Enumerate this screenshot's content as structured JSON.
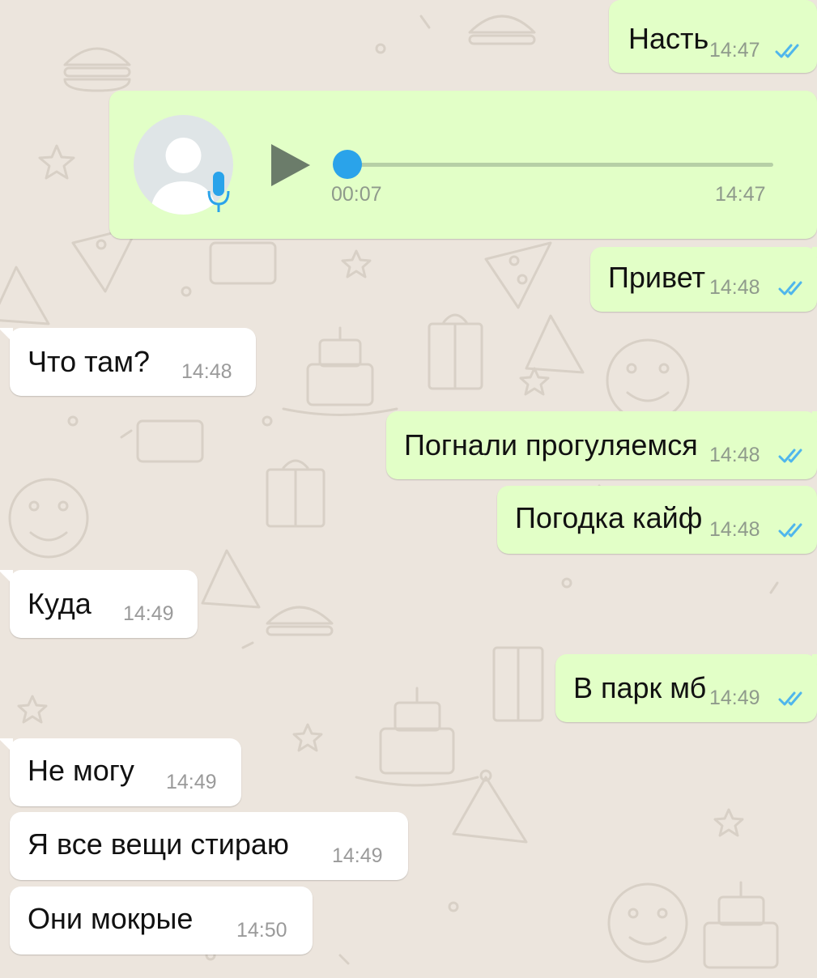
{
  "chat": {
    "messages": [
      {
        "direction": "out",
        "text": "Насть",
        "time": "14:47",
        "status": "read"
      },
      {
        "direction": "out",
        "type": "voice",
        "duration": "00:07",
        "time": "14:47",
        "playback_progress": 0.0
      },
      {
        "direction": "out",
        "text": "Привет",
        "time": "14:48",
        "status": "read"
      },
      {
        "direction": "in",
        "text": "Что там?",
        "time": "14:48"
      },
      {
        "direction": "out",
        "text": "Погнали прогуляемся",
        "time": "14:48",
        "status": "read"
      },
      {
        "direction": "out",
        "text": "Погодка кайф",
        "time": "14:48",
        "status": "read"
      },
      {
        "direction": "in",
        "text": "Куда",
        "time": "14:49"
      },
      {
        "direction": "out",
        "text": "В парк мб",
        "time": "14:49",
        "status": "read"
      },
      {
        "direction": "in",
        "text": "Не могу",
        "time": "14:49"
      },
      {
        "direction": "in",
        "text": "Я все вещи стираю",
        "time": "14:49"
      },
      {
        "direction": "in",
        "text": "Они мокрые",
        "time": "14:50"
      }
    ]
  },
  "icons": {
    "read_receipt": "double-check-icon",
    "voice_play": "play-icon",
    "voice_mic": "microphone-icon",
    "avatar": "default-avatar-icon"
  },
  "colors": {
    "wallpaper": "#ece5dd",
    "outgoing_bubble": "#e2ffc7",
    "incoming_bubble": "#ffffff",
    "read_ticks": "#4fb6ec",
    "accent": "#2aa3ea",
    "play_button": "#6b7c6a",
    "timestamp": "#8f9a8c"
  }
}
